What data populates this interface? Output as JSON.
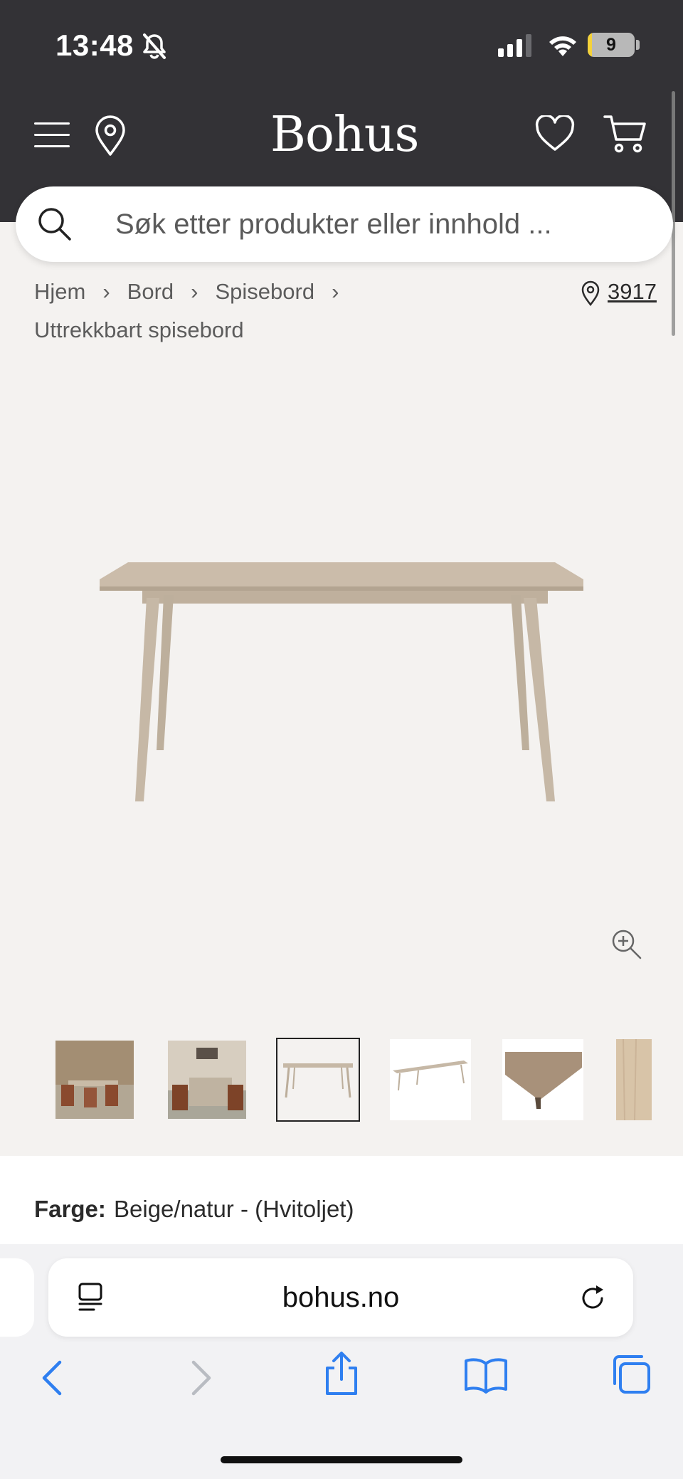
{
  "status_bar": {
    "time": "13:48",
    "battery": "9",
    "battery_level": 0.09
  },
  "header": {
    "logo": "Bohus"
  },
  "search": {
    "placeholder": "Søk etter produkter eller innhold ..."
  },
  "breadcrumb": {
    "items": [
      "Hjem",
      "Bord",
      "Spisebord"
    ],
    "current": "Uttrekkbart spisebord"
  },
  "store": {
    "number": "3917"
  },
  "product": {
    "color_label": "Farge:",
    "color_value": "Beige/natur - (Hvitoljet)",
    "wood_color": "#cdbfae"
  },
  "gallery": {
    "thumbnail_count": 6,
    "selected_index": 2
  },
  "browser": {
    "url": "bohus.no"
  },
  "colors": {
    "header_bg": "#333236",
    "page_bg": "#f4f2f0",
    "ios_blue": "#2f7ff0"
  }
}
